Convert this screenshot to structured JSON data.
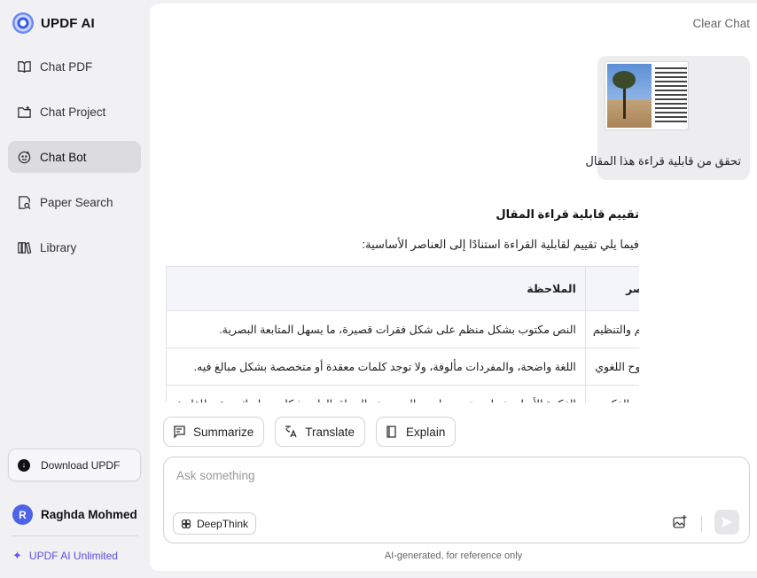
{
  "brand": {
    "name": "UPDF AI"
  },
  "sidebar": {
    "items": [
      {
        "label": "Chat PDF",
        "icon": "book-icon"
      },
      {
        "label": "Chat Project",
        "icon": "folder-icon"
      },
      {
        "label": "Chat Bot",
        "icon": "bot-icon",
        "active": true
      },
      {
        "label": "Paper Search",
        "icon": "doc-search-icon"
      },
      {
        "label": "Library",
        "icon": "library-icon"
      }
    ],
    "download_label": "Download UPDF",
    "user": {
      "initial": "R",
      "name": "Raghda Mohmed"
    },
    "unlimited_label": "UPDF AI Unlimited"
  },
  "header": {
    "clear_chat": "Clear Chat"
  },
  "conversation": {
    "user_message": "تحقق من قابلية قراءة هذا المقال",
    "answer": {
      "title": "تقييم قابلية قراءة المقال",
      "intro": "فيما يلي تقييم لقابلية القراءة استنادًا إلى العناصر الأساسية:",
      "table": {
        "headers": [
          "العنصر",
          "الملاحظة"
        ],
        "rows": [
          [
            "الحجم والتنظيم",
            "النص مكتوب بشكل منظم على شكل فقرات قصيرة، ما يسهل المتابعة البصرية."
          ],
          [
            "الوضوح اللغوي",
            "اللغة واضحة، والمفردات مألوفة، ولا توجد كلمات معقدة أو متخصصة بشكل مبالغ فيه."
          ],
          [
            "الجذب الفكري",
            "الفكرة الأساسية واضحة وتربط بين الموضوع والسياق العام بشكل متماسك ومقنع للقارئ."
          ]
        ]
      }
    }
  },
  "actions": {
    "summarize": "Summarize",
    "translate": "Translate",
    "explain": "Explain"
  },
  "composer": {
    "placeholder": "Ask something",
    "deepthink_label": "DeepThink"
  },
  "footer": {
    "disclaimer": "AI-generated, for reference only"
  }
}
